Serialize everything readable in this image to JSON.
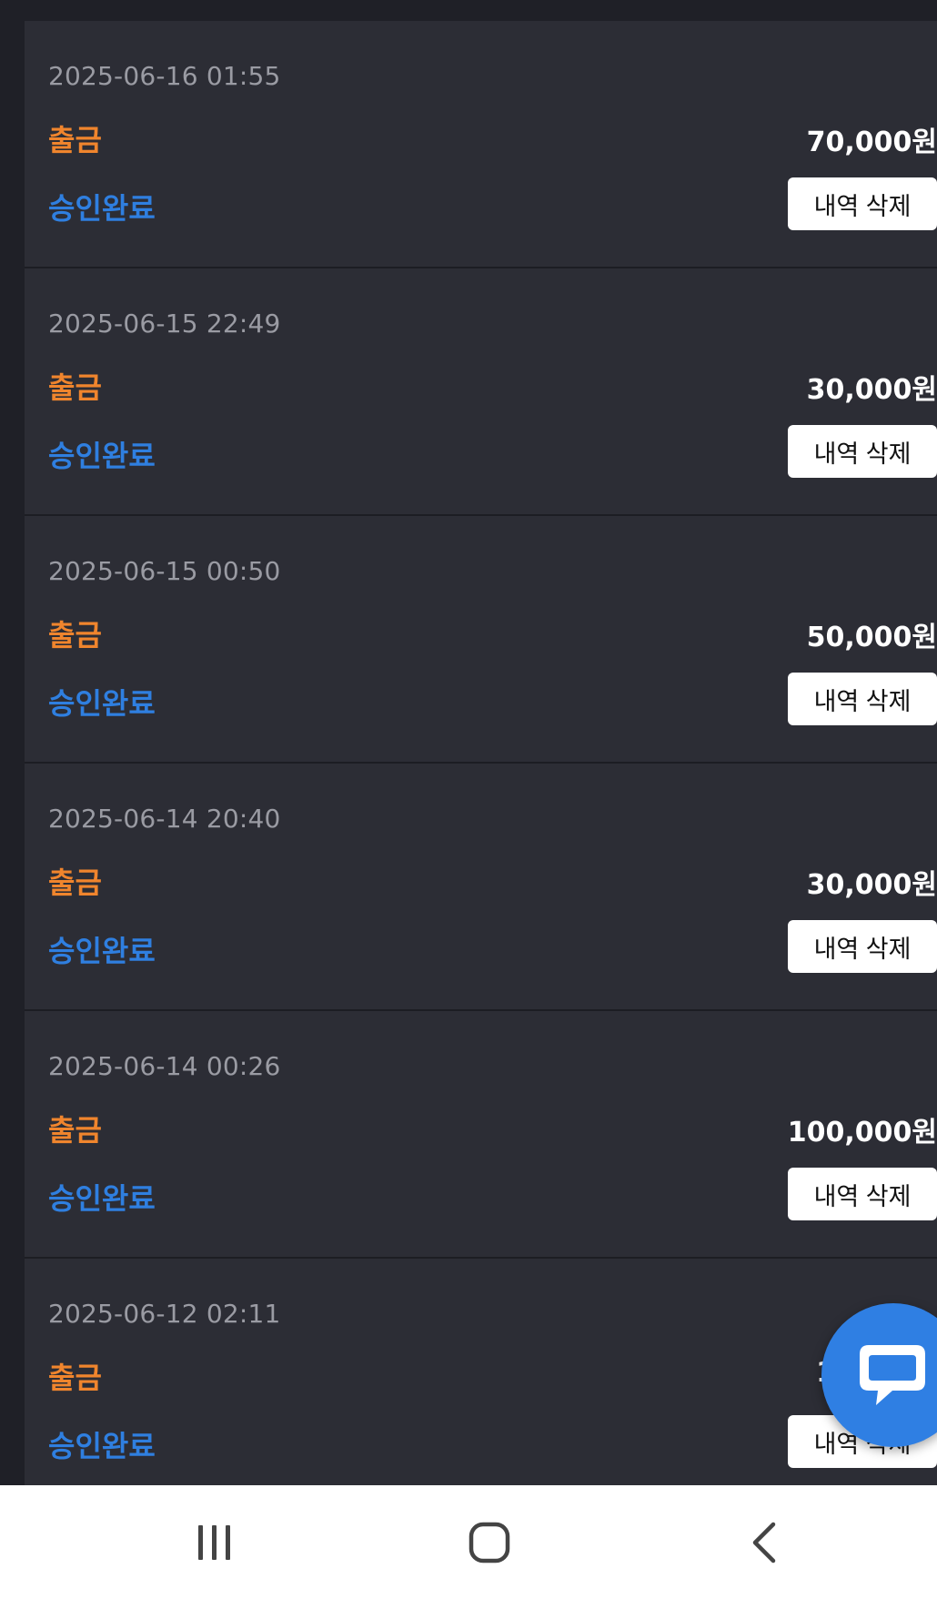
{
  "transactions": [
    {
      "date": "2025-06-16 01:55",
      "type": "출금",
      "amount": "70,000원",
      "status": "승인완료",
      "delete_label": "내역 삭제"
    },
    {
      "date": "2025-06-15 22:49",
      "type": "출금",
      "amount": "30,000원",
      "status": "승인완료",
      "delete_label": "내역 삭제"
    },
    {
      "date": "2025-06-15 00:50",
      "type": "출금",
      "amount": "50,000원",
      "status": "승인완료",
      "delete_label": "내역 삭제"
    },
    {
      "date": "2025-06-14 20:40",
      "type": "출금",
      "amount": "30,000원",
      "status": "승인완료",
      "delete_label": "내역 삭제"
    },
    {
      "date": "2025-06-14 00:26",
      "type": "출금",
      "amount": "100,000원",
      "status": "승인완료",
      "delete_label": "내역 삭제"
    },
    {
      "date": "2025-06-12 02:11",
      "type": "출금",
      "amount": "1",
      "status": "승인완료",
      "delete_label": "내역 삭제"
    }
  ],
  "colors": {
    "background": "#1f2027",
    "card": "#2c2d35",
    "type_text": "#f0852d",
    "status_text": "#2f7fe0",
    "chat_button": "#2f7fe3"
  },
  "icons": {
    "chat": "chat-bubble-icon",
    "nav_recent": "recent-apps-icon",
    "nav_home": "home-icon",
    "nav_back": "back-icon"
  }
}
